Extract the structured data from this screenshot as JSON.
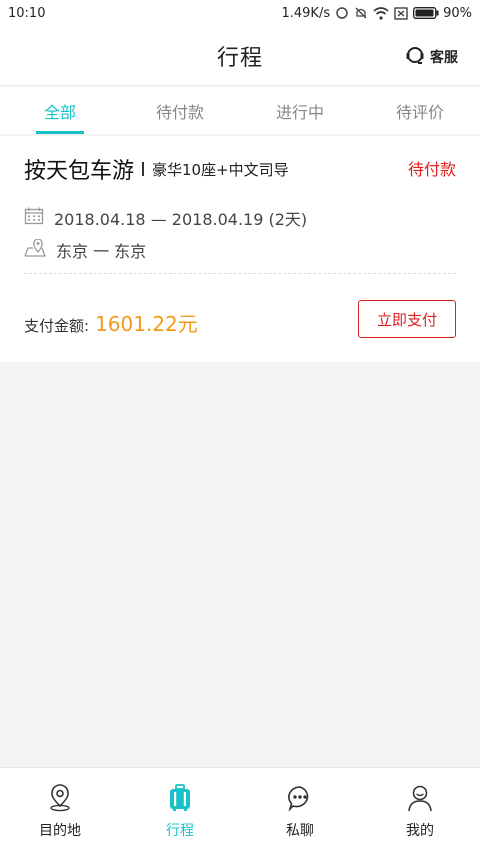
{
  "status": {
    "time": "10:10",
    "speed": "1.49K/s",
    "battery": "90%"
  },
  "navbar": {
    "title": "行程",
    "service_label": "客服"
  },
  "tabs": [
    {
      "label": "全部",
      "active": true
    },
    {
      "label": "待付款",
      "active": false
    },
    {
      "label": "进行中",
      "active": false
    },
    {
      "label": "待评价",
      "active": false
    }
  ],
  "order": {
    "title": "按天包车游",
    "subtitle": "豪华10座+中文司导",
    "status": "待付款",
    "date_range": "2018.04.18 — 2018.04.19 (2天)",
    "route": "东京 一 东京",
    "pay_label": "支付金额:",
    "pay_amount": "1601.22元",
    "pay_button": "立即支付"
  },
  "bottom_nav": [
    {
      "label": "目的地",
      "icon": "location-pin-icon",
      "active": false
    },
    {
      "label": "行程",
      "icon": "luggage-icon",
      "active": true
    },
    {
      "label": "私聊",
      "icon": "chat-bubble-icon",
      "active": false
    },
    {
      "label": "我的",
      "icon": "user-icon",
      "active": false
    }
  ],
  "colors": {
    "accent": "#19c2c9",
    "warning": "#e02020",
    "price": "#f19a1b"
  }
}
